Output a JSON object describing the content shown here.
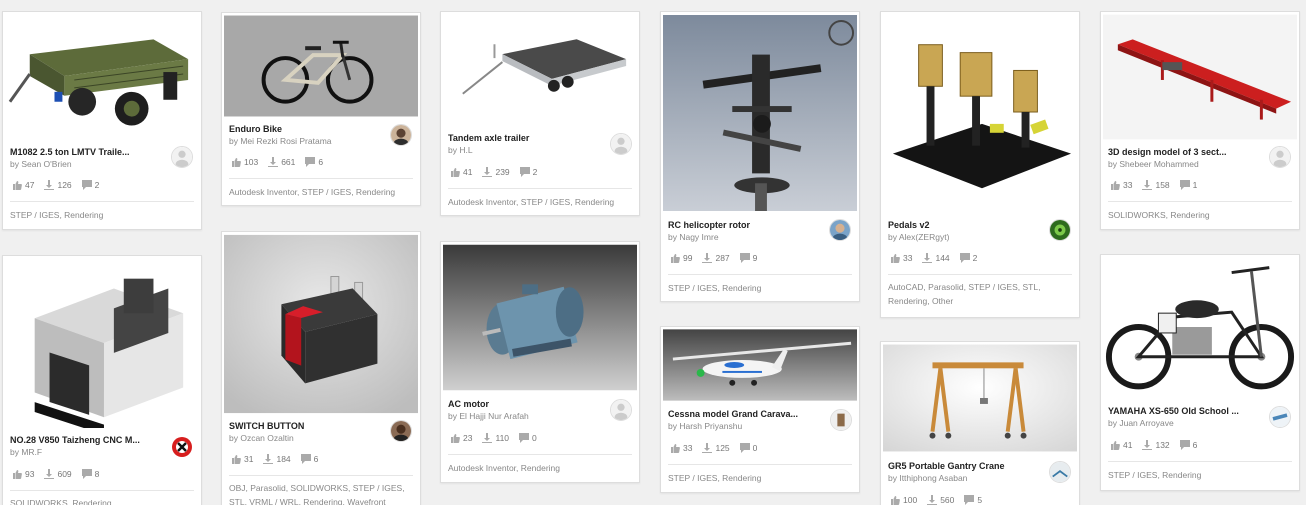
{
  "cards": [
    {
      "title": "M1082 2.5 ton LMTV Traile...",
      "author": "by Sean O'Brien",
      "likes": "47",
      "downloads": "126",
      "comments": "2",
      "tags": "STEP / IGES, Rendering",
      "avatar": "default-avatar-icon"
    },
    {
      "title": "Enduro Bike",
      "author": "by Mei Rezki Rosi Pratama",
      "likes": "103",
      "downloads": "661",
      "comments": "6",
      "tags": "Autodesk Inventor, STEP / IGES, Rendering",
      "avatar": "user-photo"
    },
    {
      "title": "Tandem axle trailer",
      "author": "by H.L",
      "likes": "41",
      "downloads": "239",
      "comments": "2",
      "tags": "Autodesk Inventor, STEP / IGES, Rendering",
      "avatar": "default-avatar-icon"
    },
    {
      "title": "RC helicopter rotor",
      "author": "by Nagy Imre",
      "likes": "99",
      "downloads": "287",
      "comments": "9",
      "tags": "STEP / IGES, Rendering",
      "avatar": "user-photo"
    },
    {
      "title": "Pedals v2",
      "author": "by Alex(ZERgyt)",
      "likes": "33",
      "downloads": "144",
      "comments": "2",
      "tags": "AutoCAD, Parasolid, STEP / IGES, STL, Rendering, Other",
      "avatar": "user-photo"
    },
    {
      "title": "3D design model of 3 sect...",
      "author": "by Shebeer Mohammed",
      "likes": "33",
      "downloads": "158",
      "comments": "1",
      "tags": "SOLIDWORKS, Rendering",
      "avatar": "default-avatar-icon"
    },
    {
      "title": "NO.28 V850 Taizheng CNC M...",
      "author": "by MR.F",
      "likes": "93",
      "downloads": "609",
      "comments": "8",
      "tags": "SOLIDWORKS, Rendering",
      "avatar": "no-entry-icon"
    },
    {
      "title": "SWITCH BUTTON",
      "author": "by Ozcan Ozaltin",
      "likes": "31",
      "downloads": "184",
      "comments": "6",
      "tags": "OBJ, Parasolid, SOLIDWORKS, STEP / IGES, STL, VRML / WRL, Rendering, Wavefront",
      "avatar": "user-photo"
    },
    {
      "title": "AC motor",
      "author": "by El Hajji Nur Arafah",
      "likes": "23",
      "downloads": "110",
      "comments": "0",
      "tags": "Autodesk Inventor, Rendering",
      "avatar": "default-avatar-icon"
    },
    {
      "title": "Cessna model Grand Carava...",
      "author": "by Harsh Priyanshu",
      "likes": "33",
      "downloads": "125",
      "comments": "0",
      "tags": "STEP / IGES, Rendering",
      "avatar": "user-photo"
    },
    {
      "title": "GR5 Portable Gantry Crane",
      "author": "by Itthiphong Asaban",
      "likes": "100",
      "downloads": "560",
      "comments": "5",
      "tags": "",
      "avatar": "user-photo"
    },
    {
      "title": "YAMAHA XS-650 Old School ...",
      "author": "by Juan Arroyave",
      "likes": "41",
      "downloads": "132",
      "comments": "6",
      "tags": "STEP / IGES, Rendering",
      "avatar": "user-photo"
    }
  ]
}
